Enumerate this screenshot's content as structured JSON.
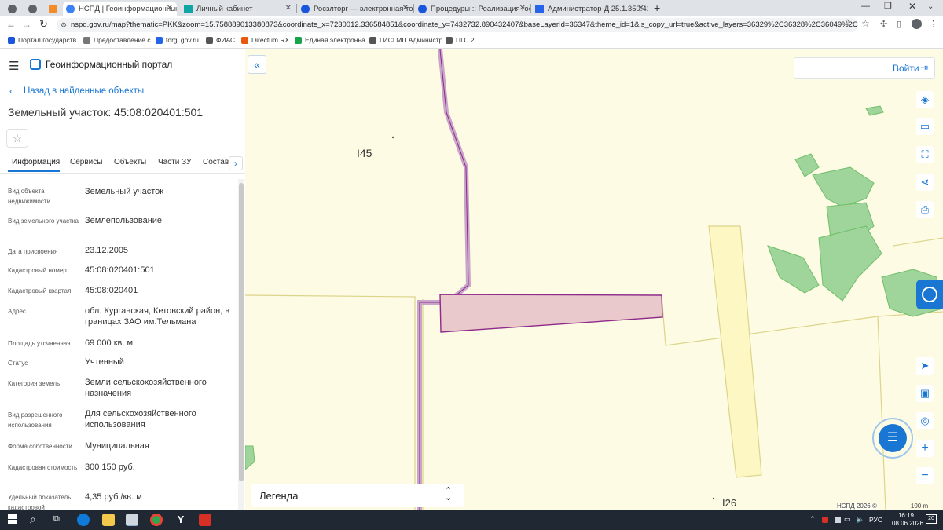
{
  "browser": {
    "tabs": [
      {
        "label": "",
        "icon_color": "#5f6368"
      },
      {
        "label": "",
        "icon_color": "#5f6368"
      },
      {
        "label": "",
        "icon_color": "#f28c28"
      },
      {
        "label": "НСПД | Геоинформационный п",
        "icon_color": "#3b82f6"
      },
      {
        "label": "Личный кабинет",
        "icon_color": "#0ea5a4"
      },
      {
        "label": "Росзлторг — электронная торг",
        "icon_color": "#1a56db"
      },
      {
        "label": "Процедуры :: Реализация госи",
        "icon_color": "#1a56db"
      },
      {
        "label": "Администратор-Д 25.1.350.417",
        "icon_color": "#2563eb"
      }
    ],
    "new_tab": "+",
    "url": "nspd.gov.ru/map?thematic=PKK&zoom=15.758889013380873&coordinate_x=7230012.336584851&coordinate_y=7432732.890432407&baseLayerId=36347&theme_id=1&is_copy_url=true&active_layers=36329%2C36328%2C36049%2C36473%2C3729...",
    "bookmarks": [
      {
        "label": "Портал государств...",
        "color": "#1a56db"
      },
      {
        "label": "Предоставление с...",
        "color": "#555"
      },
      {
        "label": "torgi.gov.ru",
        "color": "#2563eb"
      },
      {
        "label": "ФИАС",
        "color": "#444"
      },
      {
        "label": "Directum RX",
        "color": "#e8590c"
      },
      {
        "label": "Единая электронна...",
        "color": "#16a34a"
      },
      {
        "label": "ГИСГМП Администр...",
        "color": "#444"
      },
      {
        "label": "ПГС 2",
        "color": "#444"
      }
    ]
  },
  "app": {
    "title": "Геоинформационный портал",
    "back_link": "Назад в найденные объекты",
    "object_title": "Земельный участок: 45:08:020401:501",
    "collapse_label": "«",
    "login_label": "Войти",
    "tabs": [
      "Информация",
      "Сервисы",
      "Объекты",
      "Части ЗУ",
      "Состав"
    ],
    "tabs_more": "›",
    "fields": [
      {
        "label": "Вид объекта недвижимости",
        "value": "Земельный участок"
      },
      {
        "label": "Вид земельного участка",
        "value": "Землепользование"
      },
      {
        "label": "Дата присвоения",
        "value": "23.12.2005"
      },
      {
        "label": "Кадастровый номер",
        "value": "45:08:020401:501"
      },
      {
        "label": "Кадастровый квартал",
        "value": "45:08:020401"
      },
      {
        "label": "Адрес",
        "value": "обл. Курганская, Кетовский район, в границах ЗАО им.Тельмана"
      },
      {
        "label": "Площадь уточненная",
        "value": "69 000 кв. м"
      },
      {
        "label": "Статус",
        "value": "Учтенный"
      },
      {
        "label": "Категория земель",
        "value": "Земли сельскохозяйственного назначения"
      },
      {
        "label": "Вид разрешенного использования",
        "value": "Для сельскохозяйственного использования"
      },
      {
        "label": "Форма собственности",
        "value": "Муниципальная"
      },
      {
        "label": "Кадастровая стоимость",
        "value": "300 150 руб."
      },
      {
        "label": "Удельный показатель кадастровой",
        "value": "4,35 руб./кв. м"
      }
    ]
  },
  "map": {
    "labels": {
      "a": "I45",
      "b": "I26"
    },
    "legend": "Легенда",
    "legend_toggle": "⌃⌄",
    "copyright": "НСПД 2026 ©",
    "scale": "100 m",
    "colors": {
      "background": "#fdfbe3",
      "parcel_fill": "#e9c9cc",
      "parcel_stroke": "#8e2a8a",
      "forest": "#9fd49a",
      "road": "#b584b6"
    }
  },
  "taskbar": {
    "time": "16:19",
    "date": "08.06.2026",
    "lang": "РУС",
    "notif": "20"
  }
}
